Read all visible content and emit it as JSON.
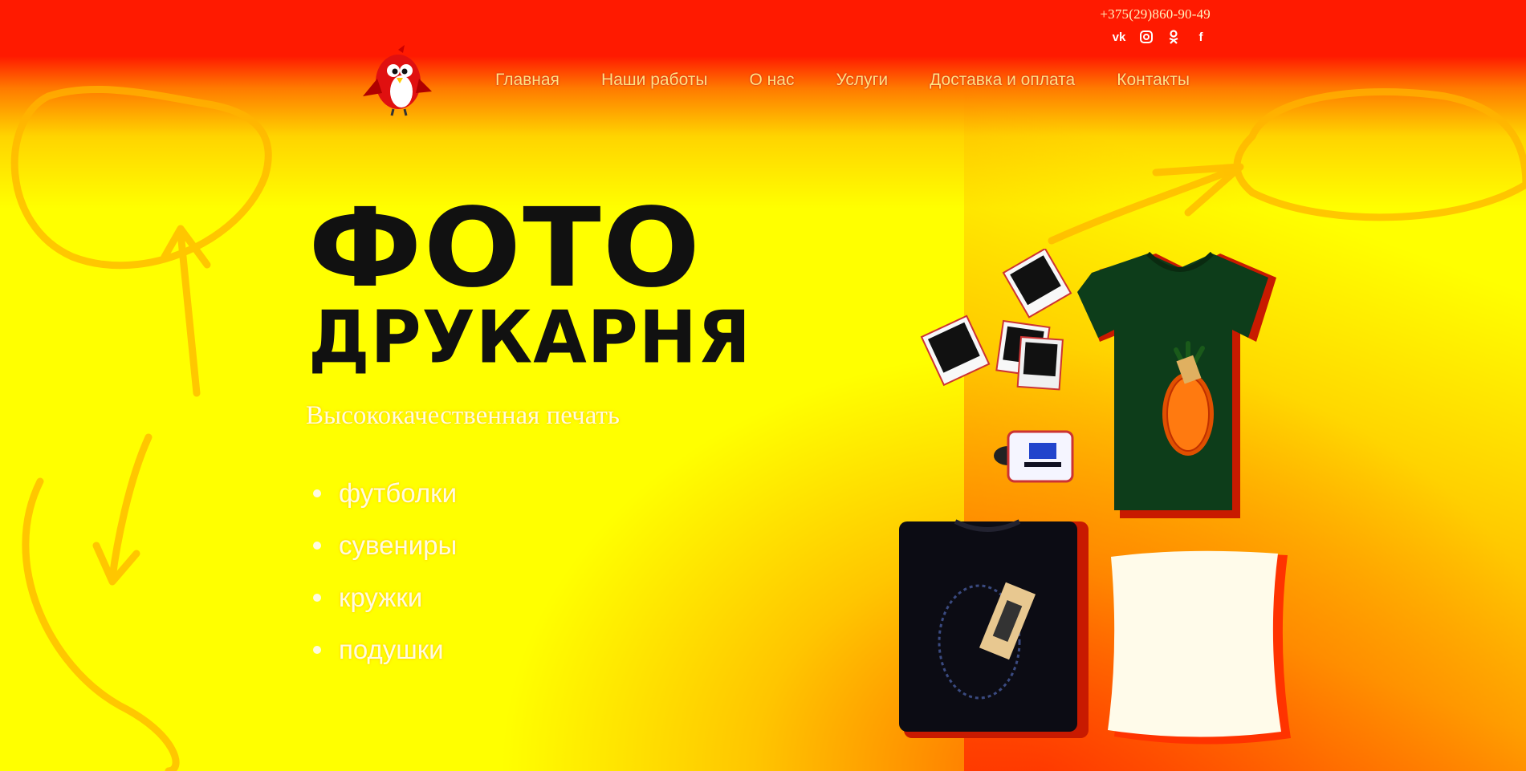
{
  "header": {
    "phone": "+375(29)860-90-49",
    "socials": [
      {
        "icon": "vk-icon",
        "glyph": "vk"
      },
      {
        "icon": "instagram-icon",
        "glyph": "◙"
      },
      {
        "icon": "odnoklassniki-icon",
        "glyph": "ꙮ"
      },
      {
        "icon": "facebook-icon",
        "glyph": "f"
      }
    ],
    "logo_icon": "red-bird-logo-icon"
  },
  "nav": {
    "items": [
      "Главная",
      "Наши работы",
      "О нас",
      "Услуги",
      "Доставка и оплата",
      "Контакты"
    ]
  },
  "hero": {
    "title_line1": "ФОТО",
    "title_line2": "ДРУКАРНЯ",
    "subtitle": "Высококачественная печать",
    "services": [
      "футболки",
      "сувениры",
      "кружки",
      "подушки"
    ]
  },
  "colors": {
    "top_bar": "#ff1a00",
    "background": "#ffff00",
    "title": "#111111",
    "nav_text": "#ffe680"
  }
}
